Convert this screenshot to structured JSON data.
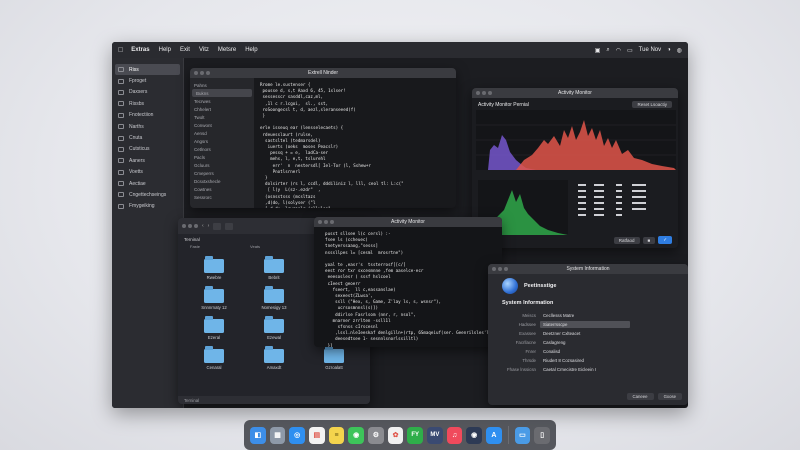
{
  "menubar": {
    "apple": "",
    "items": [
      "Extras",
      "Help",
      "Exit",
      "Vitz",
      "Metsre",
      "Help"
    ],
    "time": "Tue Nov",
    "status_icons": [
      "control-center-icon",
      "search-icon",
      "wifi-icon",
      "battery-icon"
    ]
  },
  "sidebar": {
    "items": [
      {
        "label": "Riss",
        "selected": true
      },
      {
        "label": "Fproget"
      },
      {
        "label": "Daxsers"
      },
      {
        "label": "Rissbs"
      },
      {
        "label": "Fnotectiion"
      },
      {
        "label": "Narths"
      },
      {
        "label": "Cnuta"
      },
      {
        "label": "Cutsticus"
      },
      {
        "label": "Aaners"
      },
      {
        "label": "Voetts"
      },
      {
        "label": "Aectiae"
      },
      {
        "label": "Cngettechseings"
      },
      {
        "label": "Fmygeiking"
      }
    ]
  },
  "editor": {
    "title": "Extrell Ninder",
    "side_items": [
      "Pahns",
      "Bukns",
      "Tecrwes",
      "Chhelert",
      "Twolt",
      "Conwont",
      "Aensd",
      "Angsrs",
      "Cetlnors",
      "Pacls",
      "Gcluurs",
      "Cmeperrs",
      "Dcsxtxshecle",
      "Cowtnes",
      "Sessrorc"
    ],
    "code": "Rrome le.sustenser {\n pousse d, s,t Aaxd 6, 45, 1slser!\n sessesscr sasddl,caz,ml,\n  ,1l c r.lcgoi,  sl., sst,\n roSoongecsl t, d, aezl,sleranseeed(f)\n }\n\nerle isseuq ear (lensselecaets) {\n rdeuesslaurt (rulse,\n  sastsltel (tedmarsdel)\n   iuerts (oeks  moses Peacslr)\n    pessq + = e,  ladCa-ser\n    mehs, l, e,t, tslurehl\n     err'  n  nestersdl[ Iel-Tor (l, Sshew+r\n     Pnotlsrnerl\n  }\n  dolsirter (rs l, ccdl, dddiliniz l, lll, ceol tl: L:c(\"\n   [ l(y  L(sz-.ezdr\"  ,\n  (osnsstsss (mcsltazs\n  ,d(do, l(solyser (\"l\n  [ d,dy  lrwroolr (cllulee\"\n }LT)\"\n  }"
  },
  "activity_chart": {
    "title": "Activity Monitor",
    "subtitle": "Activity Monitor Pernial",
    "pill": "Reset Lsoactiy",
    "section_label": "Preseldws Monger decsoraiter",
    "tabs": [
      "Elt",
      "Cmcraete"
    ],
    "buttons": [
      "Ratfaod",
      "Reset"
    ],
    "colors": {
      "primary": "#e0554a",
      "secondary": "#7a5ad8",
      "accent": "#2fa84a"
    }
  },
  "finder": {
    "path_label": "Terninal",
    "columns": [
      "Faste",
      "Veats"
    ],
    "folders": [
      {
        "label": "Rwebre"
      },
      {
        "label": "Bebrit"
      },
      {
        "label": "Lenedrk"
      },
      {
        "label": "Snnnrnaty 12"
      },
      {
        "label": "Nomesigy 13"
      },
      {
        "label": "Scaconry 13"
      },
      {
        "label": "Ezeral"
      },
      {
        "label": "Ezewal"
      },
      {
        "label": "Bwakre"
      },
      {
        "label": "Cenaral"
      },
      {
        "label": "Amaxdt"
      },
      {
        "label": "Gzroalatt"
      }
    ],
    "status": "Terninal"
  },
  "activity_code": {
    "title": "Activity Monitor",
    "code": "  pusst sllsee l(c cersl) :-\n  fsee ls (ccheuec)\n  tnetyerssaaog,\"sesss]\n  nsssllpes l= [cesml  mrosrtne\")\n\n  yoal te ,easr's  tssterrosf[[c/]\n  eest ror txr sxcesmnne ,fem aaselce-ecr\n   eeesoslesr ( sssf hslcoel\n   cIeest geoerr\n     fseert,  ll c,eassanslae)\n      sexeest(ZLwsa',\n      ssll (\"Hex, s, Game, Z'lay ls, s, wsnsr\"),\n       ucrsosmnnsl(s)])\n      ddirlse Fasrlsom (nnr, r, nsol\",\n     mnarner zrrlten -ssll1l\n       sfsnss cIrscesnl\n      ,lssl.nleIeeskaf denlgilln+(rtp, 6Smaqeiuf(ser. Geenrilsles'll),\n      deesedtsee 1- sesnnlsnorlssilltl)\n   }]\n  pdlessessnssrr[]\n  cnnf dtsssodrrsss)j\n  ssst 1illnsg. s. leftbla[,aws)"
  },
  "sysinfo": {
    "title": "System Information",
    "name": "Peetinsstige",
    "heading": "System Information",
    "rows": [
      {
        "key": "Meiscs",
        "value": "Cecllesss Matre"
      },
      {
        "key": "Hadssee",
        "value": "Siaterrsscpe",
        "field": true
      },
      {
        "key": "Exassee",
        "value": "Deetzner Cxlteacet"
      },
      {
        "key": "Facrllacne",
        "value": "Caslagreng"
      },
      {
        "key": "Fnrer",
        "value": "Conalisd"
      },
      {
        "key": "Thrsde",
        "value": "Riudert 8 Cozsasired"
      },
      {
        "key": "Fhase lnssicsn",
        "value": "Caetal Crnecistre Eicleein I"
      }
    ],
    "buttons": [
      "Caneee",
      "Gxose"
    ]
  },
  "dock": {
    "apps": [
      {
        "name": "finder-icon",
        "glyph": "◧",
        "color": "#3d8ee8"
      },
      {
        "name": "launchpad-icon",
        "glyph": "▦",
        "color": "#8e99a8"
      },
      {
        "name": "safari-icon",
        "glyph": "◎",
        "color": "#2f8ff0"
      },
      {
        "name": "calendar-icon",
        "glyph": "▤",
        "color": "#f2f2f2"
      },
      {
        "name": "notes-icon",
        "glyph": "≡",
        "color": "#f4d44d"
      },
      {
        "name": "messages-icon",
        "glyph": "◉",
        "color": "#3dc45a"
      },
      {
        "name": "settings-icon",
        "glyph": "⚙",
        "color": "#8a8b90"
      },
      {
        "name": "photos-icon",
        "glyph": "✿",
        "color": "#f0f0f0"
      },
      {
        "name": "facetime-icon",
        "glyph": "FY",
        "color": "#2fae4a"
      },
      {
        "name": "music-video-icon",
        "glyph": "MV",
        "color": "#3a4a72"
      },
      {
        "name": "music-icon",
        "glyph": "♫",
        "color": "#f04a5c"
      },
      {
        "name": "system-icon",
        "glyph": "◉",
        "color": "#2d3a55"
      },
      {
        "name": "appstore-icon",
        "glyph": "A",
        "color": "#2f8ff0"
      }
    ],
    "trailing": [
      {
        "name": "folder-icon",
        "glyph": "▭",
        "color": "#4a9be6"
      },
      {
        "name": "trash-icon",
        "glyph": "▯",
        "color": "#6a6b70"
      }
    ]
  }
}
